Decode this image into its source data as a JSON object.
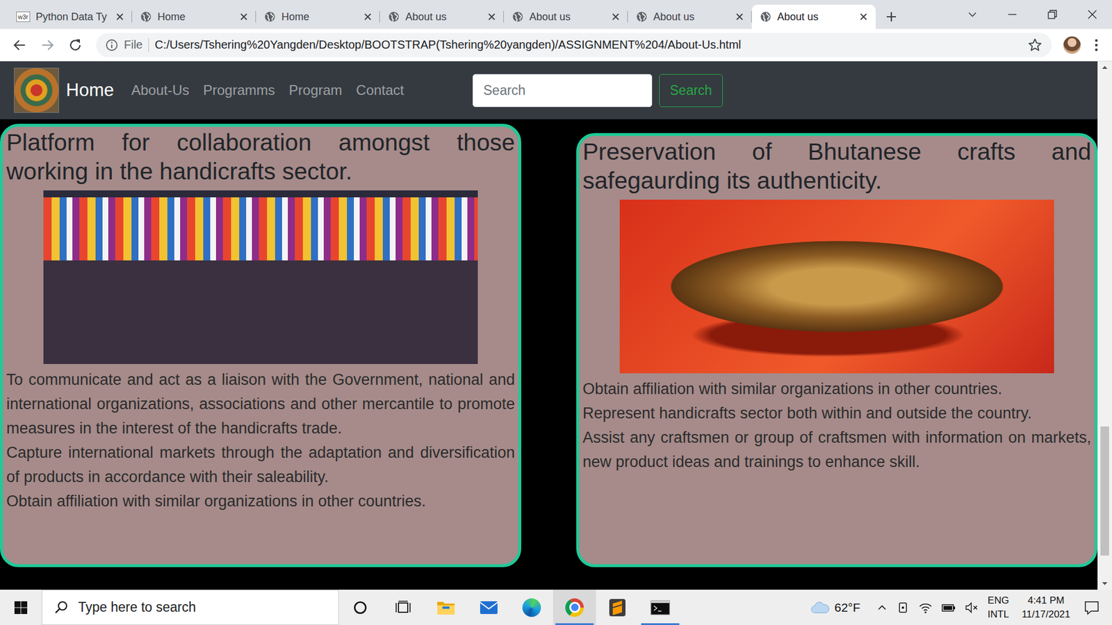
{
  "browser": {
    "tabs": [
      {
        "label": "Python Data Ty",
        "selected": false,
        "kind": "w3r",
        "icon_text": "w3r"
      },
      {
        "label": "Home",
        "selected": false,
        "kind": "globe"
      },
      {
        "label": "Home",
        "selected": false,
        "kind": "globe"
      },
      {
        "label": "About us",
        "selected": false,
        "kind": "globe"
      },
      {
        "label": "About us",
        "selected": false,
        "kind": "globe"
      },
      {
        "label": "About us",
        "selected": false,
        "kind": "globe"
      },
      {
        "label": "About us",
        "selected": true,
        "kind": "globe"
      }
    ],
    "address": {
      "scheme": "File",
      "url": "C:/Users/Tshering%20Yangden/Desktop/BOOTSTRAP(Tshering%20yangden)/ASSIGNMENT%204/About-Us.html"
    },
    "scrollbar": {
      "thumb_start": 0.7,
      "thumb_size": 0.255
    }
  },
  "navbar": {
    "brand": "Home",
    "links": [
      "About-Us",
      "Programms",
      "Program",
      "Contact"
    ],
    "search": {
      "placeholder": "Search",
      "button": "Search"
    }
  },
  "cards": [
    {
      "title": "Platform for collaboration amongst those working in the handicrafts sector.",
      "kind": "stall",
      "paragraphs": [
        "To communicate and act as a liaison with the Government, national and international organizations, associations and other mercantile to promote measures in the interest of the handicrafts trade.",
        "Capture international markets through the adaptation and diversification of products in accordance with their saleability.",
        "Obtain affiliation with similar organizations in other countries."
      ]
    },
    {
      "title": "Preservation of Bhutanese crafts and safegaurding its authenticity.",
      "kind": "bowl",
      "paragraphs": [
        "Obtain affiliation with similar organizations in other countries.",
        "Represent handicrafts sector both within and outside the country.",
        "Assist any craftsmen or group of craftsmen with information on markets, new product ideas and trainings to enhance skill."
      ]
    }
  ],
  "taskbar": {
    "search_placeholder": "Type here to search",
    "apps": [
      {
        "kind": "cortana",
        "running": false,
        "selected": false
      },
      {
        "kind": "taskview",
        "running": false,
        "selected": false
      },
      {
        "kind": "explorer",
        "running": false,
        "selected": false
      },
      {
        "kind": "mail",
        "running": false,
        "selected": false
      },
      {
        "kind": "edge",
        "running": false,
        "selected": false
      },
      {
        "kind": "chrome",
        "running": true,
        "selected": true
      },
      {
        "kind": "sublime",
        "running": false,
        "selected": false
      },
      {
        "kind": "terminal",
        "running": true,
        "selected": false
      }
    ],
    "weather": "62°F",
    "language": [
      "ENG",
      "INTL"
    ],
    "time": "4:41 PM",
    "date": "11/17/2021"
  }
}
